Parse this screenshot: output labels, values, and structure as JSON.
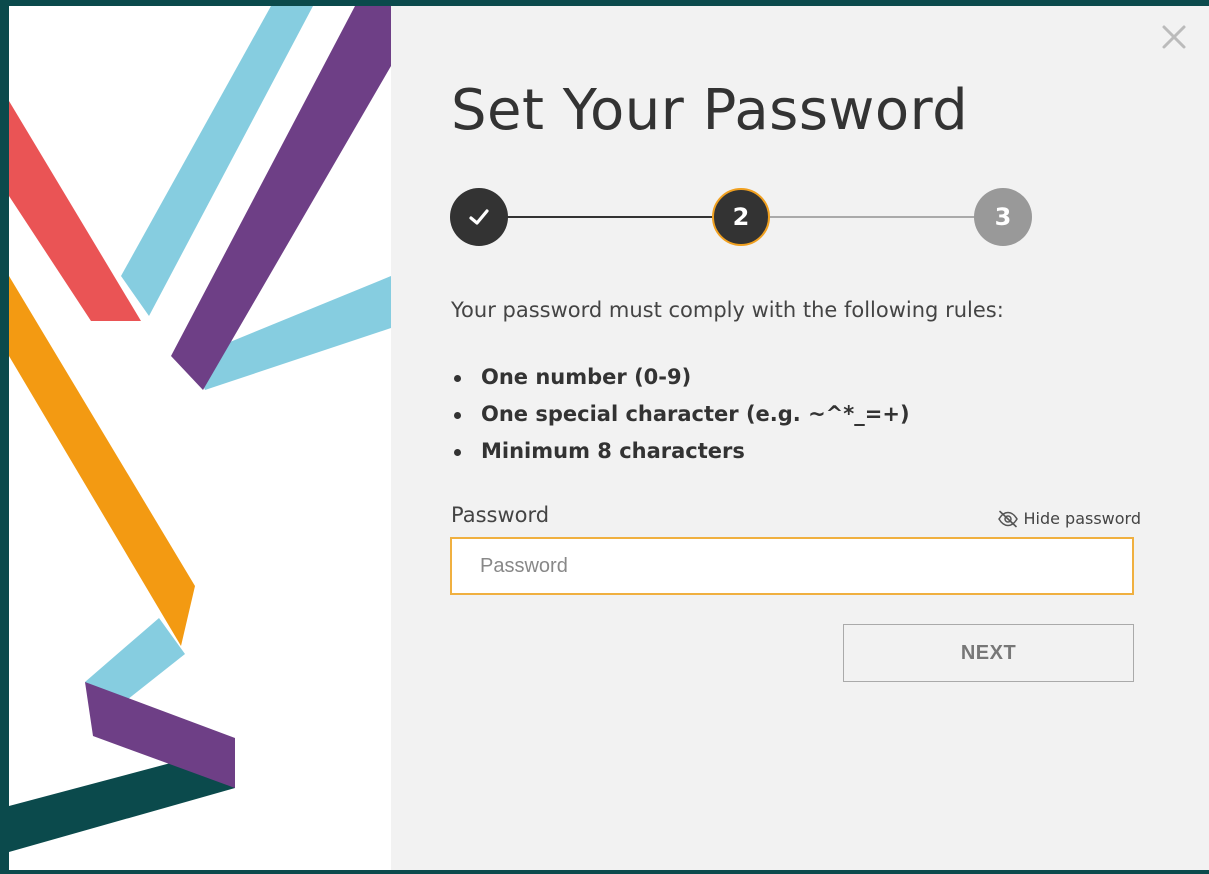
{
  "colors": {
    "frame": "#0b4a4c",
    "panel_bg": "#f2f2f2",
    "accent": "#f0a020",
    "step_done": "#333333",
    "step_todo": "#999999",
    "ribbon_red": "#ea5455",
    "ribbon_blue": "#86cde0",
    "ribbon_purple": "#6e3f86",
    "ribbon_orange": "#f39a12",
    "ribbon_teal": "#0b4a4c"
  },
  "dialog": {
    "close_icon": "close-icon",
    "title": "Set Your Password"
  },
  "stepper": {
    "current_step": 2,
    "steps": [
      {
        "state": "completed",
        "label": "",
        "icon": "checkmark-icon"
      },
      {
        "state": "current",
        "label": "2"
      },
      {
        "state": "upcoming",
        "label": "3"
      }
    ]
  },
  "rules": {
    "intro": "Your password must comply with the following rules:",
    "items": [
      "One number (0-9)",
      "One special character (e.g. ~^*_=+)",
      "Minimum 8 characters"
    ]
  },
  "password_field": {
    "label": "Password",
    "placeholder": "Password",
    "value": "",
    "toggle_label": "Hide password",
    "toggle_icon": "eye-off-icon"
  },
  "actions": {
    "next_label": "NEXT"
  }
}
